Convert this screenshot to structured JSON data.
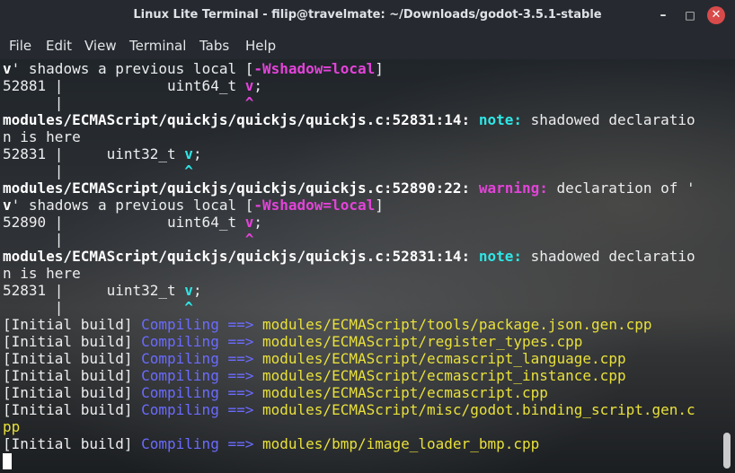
{
  "window": {
    "title": "Linux Lite Terminal - filip@travelmate: ~/Downloads/godot-3.5.1-stable",
    "controls": {
      "minimize": "–",
      "maximize": "□",
      "close": "✕"
    }
  },
  "menu": [
    "File",
    "Edit",
    "View",
    "Terminal",
    "Tabs",
    "Help"
  ],
  "terminal": {
    "lines": {
      "l1a": "v",
      "l1b": "' shadows a previous local [",
      "l1c": "-Wshadow=local",
      "l1d": "]",
      "l2a": "52881 |            uint64_t ",
      "l2b": "v",
      "l2c": ";",
      "l3a": "      |                     ",
      "l3b": "^",
      "l4a": "modules/ECMAScript/quickjs/quickjs/quickjs.c:52831:14:",
      "l4b": " ",
      "l4c": "note:",
      "l4d": " shadowed declaratio",
      "l5": "n is here",
      "l6a": "52831 |     uint32_t ",
      "l6b": "v",
      "l6c": ";",
      "l7a": "      |              ",
      "l7b": "^",
      "l8a": "modules/ECMAScript/quickjs/quickjs/quickjs.c:52890:22:",
      "l8b": " ",
      "l8c": "warning:",
      "l8d": " declaration of '",
      "l9a": "v",
      "l9b": "' shadows a previous local [",
      "l9c": "-Wshadow=local",
      "l9d": "]",
      "l10a": "52890 |            uint64_t ",
      "l10b": "v",
      "l10c": ";",
      "l11a": "      |                     ",
      "l11b": "^",
      "l12a": "modules/ECMAScript/quickjs/quickjs/quickjs.c:52831:14:",
      "l12b": " ",
      "l12c": "note:",
      "l12d": " shadowed declaratio",
      "l13": "n is here",
      "l14a": "52831 |     uint32_t ",
      "l14b": "v",
      "l14c": ";",
      "l15a": "      |              ",
      "l15b": "^"
    },
    "build": [
      {
        "prefix": "[Initial build] ",
        "verb": "Compiling",
        "arrow": " ==> ",
        "path": "modules/ECMAScript/tools/package.json.gen.cpp"
      },
      {
        "prefix": "[Initial build] ",
        "verb": "Compiling",
        "arrow": " ==> ",
        "path": "modules/ECMAScript/register_types.cpp"
      },
      {
        "prefix": "[Initial build] ",
        "verb": "Compiling",
        "arrow": " ==> ",
        "path": "modules/ECMAScript/ecmascript_language.cpp"
      },
      {
        "prefix": "[Initial build] ",
        "verb": "Compiling",
        "arrow": " ==> ",
        "path": "modules/ECMAScript/ecmascript_instance.cpp"
      },
      {
        "prefix": "[Initial build] ",
        "verb": "Compiling",
        "arrow": " ==> ",
        "path": "modules/ECMAScript/ecmascript.cpp"
      },
      {
        "prefix": "[Initial build] ",
        "verb": "Compiling",
        "arrow": " ==> ",
        "path": "modules/ECMAScript/misc/godot.binding_script.gen.c"
      },
      {
        "wrap": "pp"
      },
      {
        "prefix": "[Initial build] ",
        "verb": "Compiling",
        "arrow": " ==> ",
        "path": "modules/bmp/image_loader_bmp.cpp"
      }
    ]
  },
  "colors": {
    "bold_white": "#ffffff",
    "magenta": "#e343d9",
    "cyan": "#2ee6e6",
    "blue": "#6b6bff",
    "yellow": "#e8e03a",
    "close_button": "#d94a4a"
  }
}
